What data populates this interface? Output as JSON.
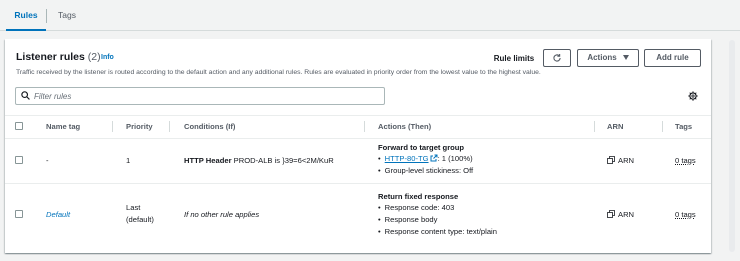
{
  "tabs": [
    {
      "label": "Rules",
      "selected": true
    },
    {
      "label": "Tags",
      "selected": false
    }
  ],
  "panel": {
    "title": "Listener rules",
    "count": "(2)",
    "info_label": "Info",
    "description": "Traffic received by the listener is routed according to the default action and any additional rules. Rules are evaluated in priority order from the lowest value to the highest value.",
    "buttons": {
      "rule_limits": "Rule limits",
      "actions": "Actions",
      "add_rule": "Add rule"
    },
    "search": {
      "placeholder": "Filter rules",
      "value": ""
    }
  },
  "table": {
    "columns": [
      "Name tag",
      "Priority",
      "Conditions (If)",
      "Actions (Then)",
      "ARN",
      "Tags"
    ],
    "rows": [
      {
        "name_tag": "-",
        "priority": "1",
        "condition_label": "HTTP Header",
        "condition_value": "PROD-ALB is }39=6<2M/KuR",
        "action_title": "Forward to target group",
        "target_group": "HTTP-80-TG",
        "target_weight": ": 1 (100%)",
        "stickiness": "Group-level stickiness: Off",
        "arn": "ARN",
        "tags": "0 tags"
      },
      {
        "name_tag": "Default",
        "priority_line1": "Last",
        "priority_line2": "(default)",
        "condition": "If no other rule applies",
        "action_title": "Return fixed response",
        "details": [
          "Response code: 403",
          "Response body",
          "Response content type: text/plain"
        ],
        "arn": "ARN",
        "tags": "0 tags"
      }
    ]
  },
  "colors": {
    "accent": "#0073bb",
    "background": "#f2f3f3",
    "text": "#16191f",
    "muted": "#545b64"
  }
}
